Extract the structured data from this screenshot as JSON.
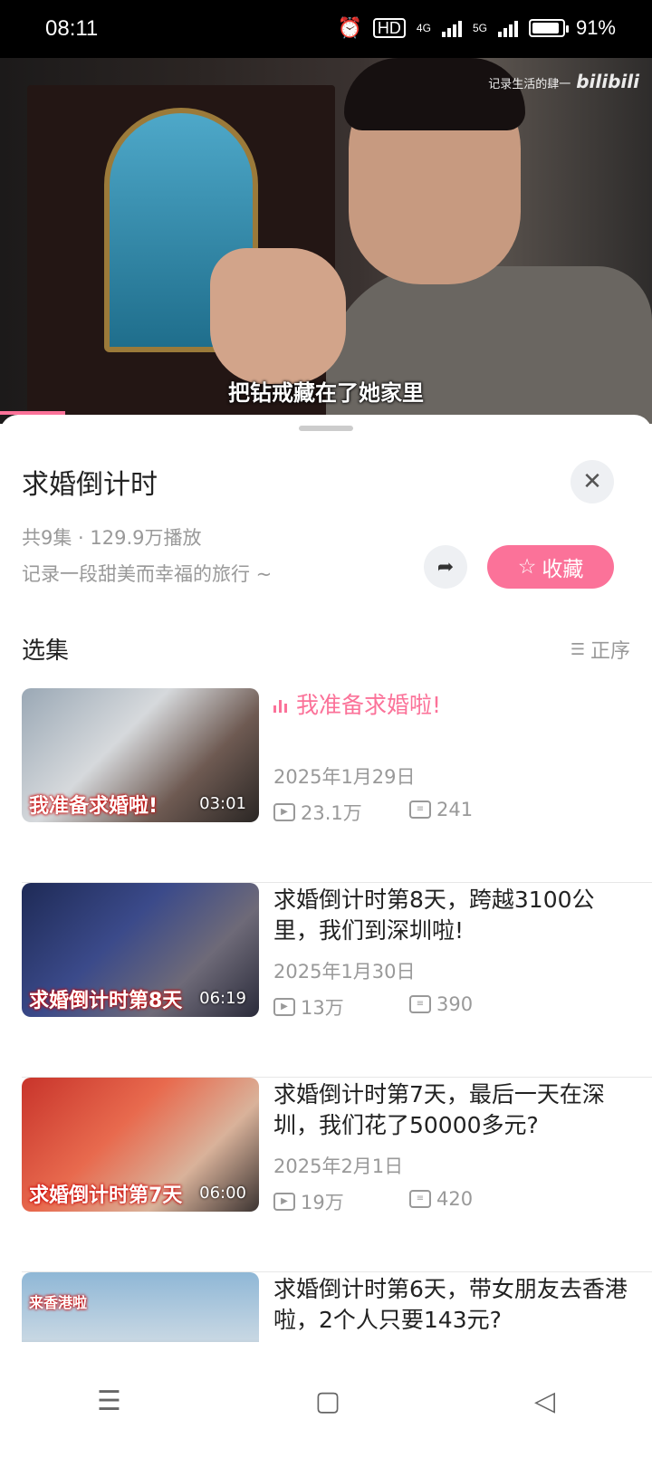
{
  "status_bar": {
    "time": "08:11",
    "hd": "HD",
    "net4g": "4G",
    "net5g": "5G",
    "battery": "91%",
    "battery_level": 0.91
  },
  "video": {
    "watermark": "记录生活的肆一",
    "brand": "bilibili",
    "subtitle": "把钻戒藏在了她家里",
    "progress_percent": 10
  },
  "sheet": {
    "title": "求婚倒计时",
    "meta": "共9集 · 129.9万播放",
    "desc": "记录一段甜美而幸福的旅行 ~",
    "fav_label": "收藏",
    "section_title": "选集",
    "order_label": "正序"
  },
  "episodes": [
    {
      "title": "我准备求婚啦!",
      "date": "2025年1月29日",
      "views": "23.1万",
      "comments": "241",
      "duration": "03:01",
      "caption": "我准备求婚啦!"
    },
    {
      "title": "求婚倒计时第8天，跨越3100公里，我们到深圳啦!",
      "date": "2025年1月30日",
      "views": "13万",
      "comments": "390",
      "duration": "06:19",
      "caption": "求婚倒计时第8天"
    },
    {
      "title": "求婚倒计时第7天，最后一天在深圳，我们花了50000多元?",
      "date": "2025年2月1日",
      "views": "19万",
      "comments": "420",
      "duration": "06:00",
      "caption": "求婚倒计时第7天"
    },
    {
      "title": "求婚倒计时第6天，带女朋友去香港啦，2个人只要143元?",
      "date": "",
      "views": "",
      "comments": "",
      "duration": "",
      "caption": "来香港啦"
    }
  ]
}
